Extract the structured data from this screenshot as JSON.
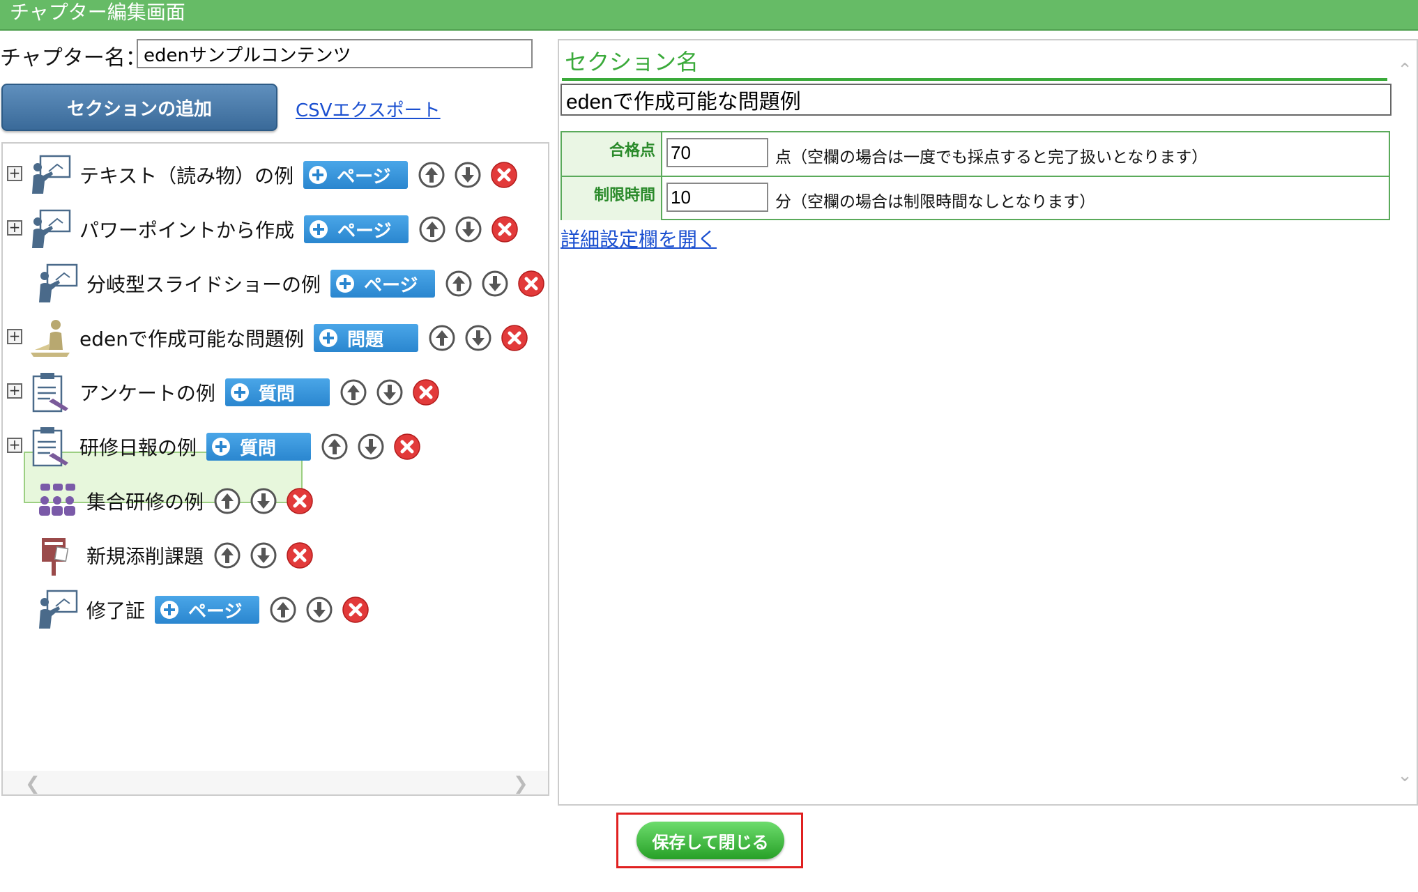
{
  "window": {
    "title": "チャプター編集画面"
  },
  "chapter": {
    "label": "チャプター名：",
    "value": "edenサンプルコンテンツ"
  },
  "toolbar": {
    "add_section": "セクションの追加",
    "csv_export": "CSVエクスポート"
  },
  "tree": {
    "items": [
      {
        "label": "テキスト（読み物）の例",
        "icon": "presenter-icon",
        "pill": "ページ",
        "expandable": true
      },
      {
        "label": "パワーポイントから作成",
        "icon": "presenter-icon",
        "pill": "ページ",
        "expandable": true
      },
      {
        "label": "分岐型スライドショーの例",
        "icon": "presenter-icon",
        "pill": "ページ",
        "expandable": false
      },
      {
        "label": "edenで作成可能な問題例",
        "icon": "test-taker-icon",
        "pill": "問題",
        "expandable": true,
        "selected": true
      },
      {
        "label": "アンケートの例",
        "icon": "clipboard-icon",
        "pill": "質問",
        "expandable": true
      },
      {
        "label": "研修日報の例",
        "icon": "clipboard-icon",
        "pill": "質問",
        "expandable": true
      },
      {
        "label": "集合研修の例",
        "icon": "group-icon",
        "pill": "",
        "expandable": false
      },
      {
        "label": "新規添削課題",
        "icon": "postbox-icon",
        "pill": "",
        "expandable": false
      },
      {
        "label": "修了証",
        "icon": "presenter-icon",
        "pill": "ページ",
        "expandable": false
      }
    ]
  },
  "section": {
    "title": "セクション名",
    "name_value": "edenで作成可能な問題例",
    "passing": {
      "label": "合格点",
      "value": "70",
      "note": "点（空欄の場合は一度でも採点すると完了扱いとなります）"
    },
    "time_limit": {
      "label": "制限時間",
      "value": "10",
      "note": "分（空欄の場合は制限時間なしとなります）"
    },
    "detail_link": "詳細設定欄を開く"
  },
  "footer": {
    "save_close": "保存して閉じる"
  },
  "colors": {
    "title_bar": "#66bb66",
    "accent_green": "#3aaa3a",
    "pill_blue": "#2a86cf",
    "link_blue": "#1a4fd0",
    "highlight_frame": "#e02020"
  }
}
